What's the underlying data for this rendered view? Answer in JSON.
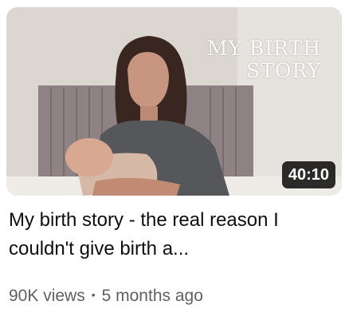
{
  "video": {
    "overlay_text": "MY BIRTH\nSTORY",
    "duration": "40:10",
    "title": "My birth story - the real reason I couldn't give birth a...",
    "views": "90K views",
    "separator": "•",
    "published": "5 months ago"
  },
  "colors": {
    "title_text": "#0f0f0f",
    "meta_text": "#606060",
    "duration_bg": "#000000"
  }
}
